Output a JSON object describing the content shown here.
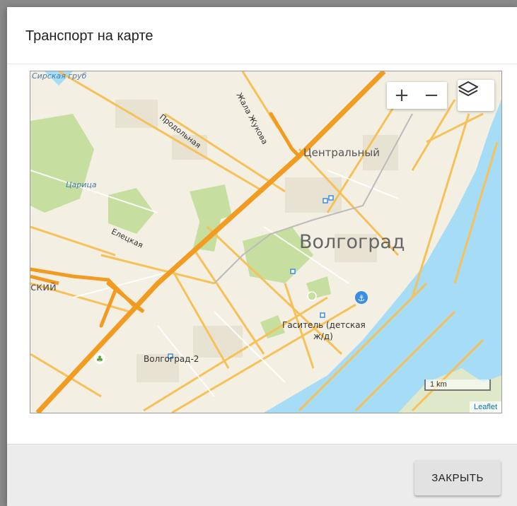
{
  "dialog": {
    "title": "Транспорт на карте",
    "close_label": "ЗАКРЫТЬ"
  },
  "map": {
    "labels": {
      "top_left": "Сирская груб",
      "zhukova": "Жала Жукова",
      "prodolnaya": "Продольная",
      "tsentralny": "Центральный",
      "tsaritsa": "Царица",
      "eletskaya": "Елецкая",
      "volgograd": "Волгоград",
      "skiy": "ский",
      "gasitel_1": "Гаситель (детская",
      "gasitel_2": "ж/д)",
      "volgograd2": "Волгоград-2"
    },
    "controls": {
      "zoom_in": "+",
      "zoom_out": "−",
      "layers_icon": "layers-icon"
    },
    "scale_label": "1 km",
    "attribution": "Leaflet"
  },
  "colors": {
    "major_road": "#f29b21",
    "minor_road": "#f7c15a",
    "water": "#a6dcf5",
    "park": "#c6dfa0",
    "land": "#f3efe2"
  }
}
